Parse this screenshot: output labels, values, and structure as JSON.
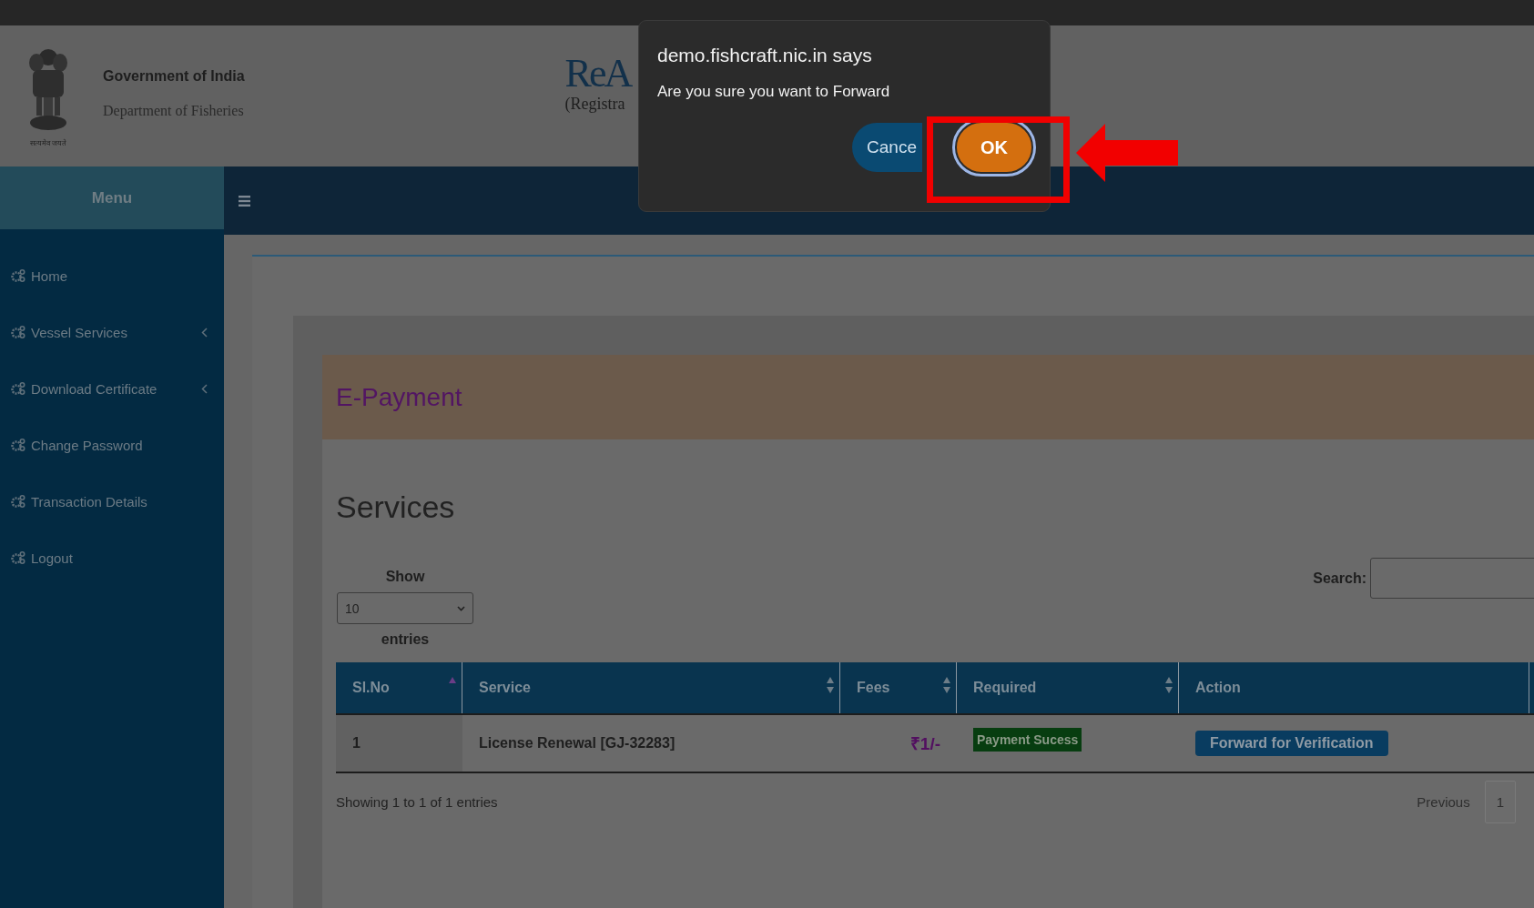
{
  "header": {
    "emblem_caption": "सत्यमेव जयते",
    "title": "Government of India",
    "subtitle": "Department of Fisheries",
    "logo_text": "ReA",
    "logo_subtext": "(Registra"
  },
  "sidebar": {
    "heading": "Menu",
    "items": [
      {
        "label": "Home",
        "kind": "link"
      },
      {
        "label": "Vessel Services",
        "kind": "submenu"
      },
      {
        "label": "Download Certificate",
        "kind": "submenu"
      },
      {
        "label": "Change Password",
        "kind": "link"
      },
      {
        "label": "Transaction Details",
        "kind": "link"
      },
      {
        "label": "Logout",
        "kind": "link"
      }
    ]
  },
  "page": {
    "heading": "E-Payment",
    "section_title": "Services",
    "length_menu": {
      "label_before": "Show",
      "value": "10",
      "label_after": "entries"
    },
    "search": {
      "label": "Search:"
    },
    "table": {
      "columns": [
        {
          "label": "Sl.No",
          "sortable": true,
          "sorted": true
        },
        {
          "label": "Service",
          "sortable": true,
          "sorted": false
        },
        {
          "label": "Fees",
          "sortable": true,
          "sorted": false
        },
        {
          "label": "Required",
          "sortable": true,
          "sorted": false
        },
        {
          "label": "Action",
          "sortable": false,
          "sorted": false
        }
      ],
      "rows": [
        {
          "sl_no": "1",
          "service": "License Renewal [GJ-32283]",
          "fees": "₹1/-",
          "required": "Payment Sucess",
          "action": "Forward for Verification"
        }
      ]
    },
    "info": "Showing 1 to 1 of 1 entries",
    "pagination": {
      "previous": "Previous",
      "pages": [
        {
          "label": "1",
          "selected": true
        }
      ]
    }
  },
  "dialog": {
    "title": "demo.fishcraft.nic.in says",
    "message": "Are you sure you want to Forward",
    "buttons": [
      {
        "label": "Cance",
        "kind": "cancel"
      },
      {
        "label": "OK",
        "kind": "ok"
      }
    ]
  }
}
